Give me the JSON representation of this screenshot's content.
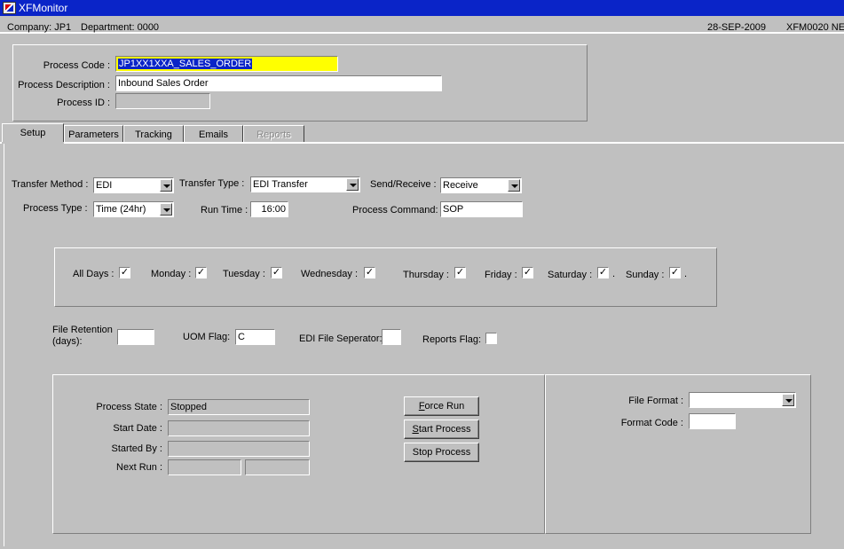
{
  "window": {
    "title": "XFMonitor"
  },
  "header": {
    "company": "Company: JP1",
    "department": "Department: 0000",
    "date": "28-SEP-2009",
    "form_code": "XFM0020 NE"
  },
  "process": {
    "code_label": "Process Code :",
    "code_value": "JP1XX1XXA_SALES_ORDER",
    "desc_label": "Process Description :",
    "desc_value": "Inbound Sales Order",
    "id_label": "Process ID :",
    "id_value": ""
  },
  "tabs": [
    {
      "label": "Setup",
      "active": true
    },
    {
      "label": "Parameters"
    },
    {
      "label": "Tracking"
    },
    {
      "label": "Emails"
    },
    {
      "label": "Reports",
      "disabled": true
    }
  ],
  "setup": {
    "transfer_method_label": "Transfer Method :",
    "transfer_method_value": "EDI",
    "transfer_type_label": "Transfer Type :",
    "transfer_type_value": "EDI Transfer",
    "send_receive_label": "Send/Receive :",
    "send_receive_value": "Receive",
    "process_type_label": "Process Type :",
    "process_type_value": "Time (24hr)",
    "run_time_label": "Run Time :",
    "run_time_value": "16:00",
    "process_command_label": "Process Command:",
    "process_command_value": "SOP",
    "days": [
      {
        "label": "All Days :",
        "checked": true
      },
      {
        "label": "Monday :",
        "checked": true
      },
      {
        "label": "Tuesday :",
        "checked": true
      },
      {
        "label": "Wednesday :",
        "checked": true
      },
      {
        "label": "Thursday :",
        "checked": true
      },
      {
        "label": "Friday :",
        "checked": true
      },
      {
        "label": "Saturday :",
        "checked": true
      },
      {
        "label": "Sunday :",
        "checked": true
      }
    ],
    "check_mark": "✓",
    "dot": ".",
    "file_retention_label_1": "File Retention",
    "file_retention_label_2": "(days):",
    "file_retention_value": "",
    "uom_flag_label": "UOM Flag:",
    "uom_flag_value": "C",
    "edi_sep_label": "EDI File Seperator:",
    "edi_sep_value": "",
    "reports_flag_label": "Reports Flag:"
  },
  "status": {
    "process_state_label": "Process State :",
    "process_state_value": "Stopped",
    "start_date_label": "Start Date :",
    "start_date_value": "",
    "started_by_label": "Started By :",
    "started_by_value": "",
    "next_run_label": "Next Run :",
    "next_run_date": "",
    "next_run_time": ""
  },
  "buttons": {
    "force_run_key": "F",
    "force_run_rest": "orce Run",
    "start_process_key": "S",
    "start_process_rest": "tart Process",
    "stop_process": "Stop Process"
  },
  "format": {
    "file_format_label": "File Format :",
    "file_format_value": "",
    "format_code_label": "Format Code :",
    "format_code_value": ""
  },
  "colors": {
    "titlebar": "#0a24c8",
    "background": "#c0c0c0",
    "highlight": "#ffff00"
  }
}
